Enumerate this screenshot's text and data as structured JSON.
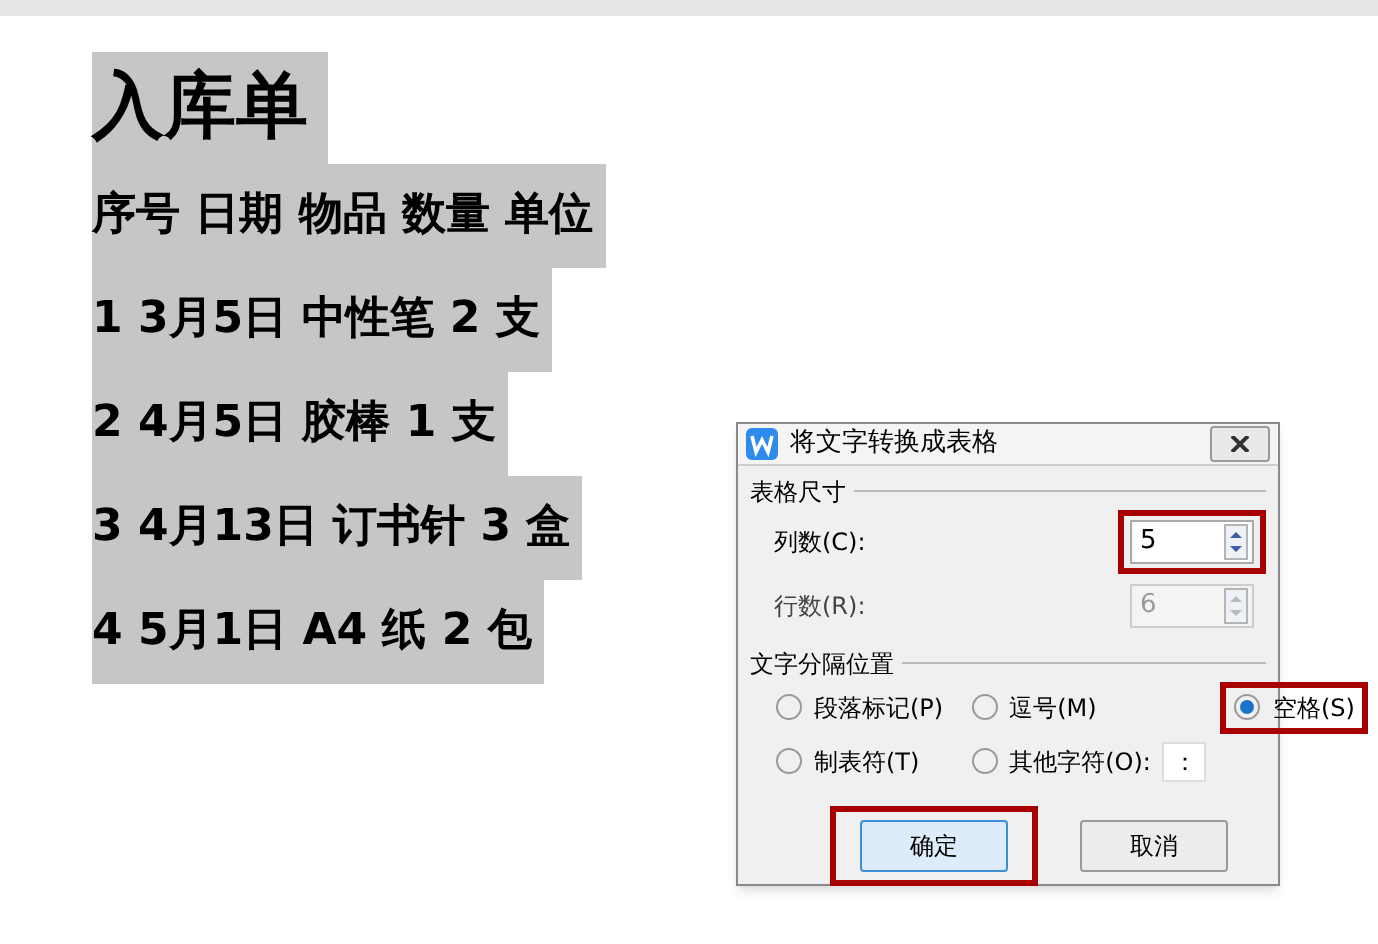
{
  "document": {
    "title": "入库单",
    "lines": [
      "序号 日期 物品 数量 单位",
      "1 3月5日 中性笔 2 支",
      "2 4月5日 胶棒 1 支",
      "3 4月13日 订书针 3 盒",
      "4 5月1日 A4 纸 2 包"
    ]
  },
  "dialog": {
    "title": "将文字转换成表格",
    "size_section": "表格尺寸",
    "columns": {
      "label": "列数(C):",
      "value": "5",
      "disabled": false,
      "highlighted": true
    },
    "rows": {
      "label": "行数(R):",
      "value": "6",
      "disabled": true,
      "highlighted": false
    },
    "separator_section": "文字分隔位置",
    "separators": [
      {
        "label": "段落标记(P)",
        "selected": false,
        "highlighted": false
      },
      {
        "label": "逗号(M)",
        "selected": false,
        "highlighted": false
      },
      {
        "label": "空格(S)",
        "selected": true,
        "highlighted": true
      },
      {
        "label": "制表符(T)",
        "selected": false,
        "highlighted": false
      },
      {
        "label": "其他字符(O):",
        "selected": false,
        "highlighted": false,
        "value": "："
      }
    ],
    "buttons": [
      {
        "label": "确定",
        "default": true,
        "highlighted": true
      },
      {
        "label": "取消",
        "default": false,
        "highlighted": false
      }
    ]
  }
}
